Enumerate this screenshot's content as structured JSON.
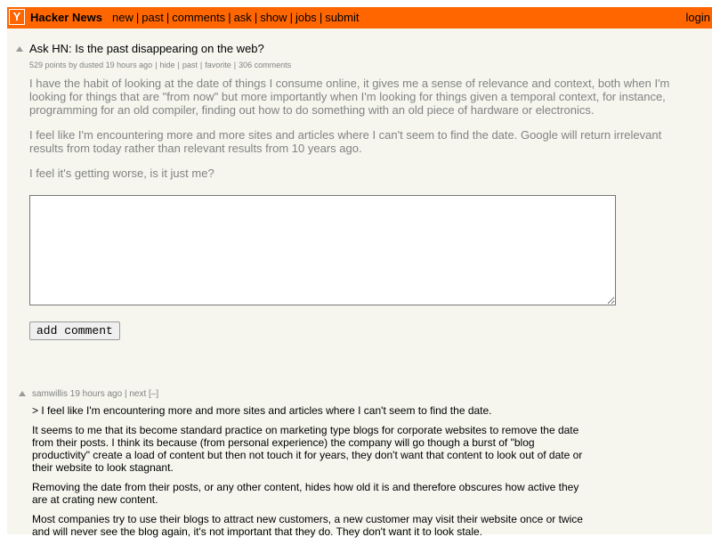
{
  "header": {
    "logo": "Y",
    "site_name": "Hacker News",
    "nav": [
      "new",
      "past",
      "comments",
      "ask",
      "show",
      "jobs",
      "submit"
    ],
    "separator": "|",
    "login": "login"
  },
  "story": {
    "title": "Ask HN: Is the past disappearing on the web?",
    "points": "529 points",
    "by": "by",
    "user": "dusted",
    "age": "19 hours ago",
    "links": [
      "hide",
      "past",
      "favorite",
      "306 comments"
    ],
    "paragraphs": [
      "I have the habit of looking at the date of things I consume online, it gives me a sense of relevance and context, both when I'm looking for things that are \"from now\" but more importantly when I'm looking for things given a temporal context, for instance, programming for an old compiler, finding out how to do something with an old piece of hardware or electronics.",
      "I feel like I'm encountering more and more sites and articles where I can't seem to find the date. Google will return irrelevant results from today rather than relevant results from 10 years ago.",
      "I feel it's getting worse, is it just me?"
    ]
  },
  "reply": {
    "textarea_value": "",
    "button_label": "add comment"
  },
  "comment": {
    "user": "samwillis",
    "age": "19 hours ago",
    "next": "next",
    "toggle": "[–]",
    "paragraphs": [
      "> I feel like I'm encountering more and more sites and articles where I can't seem to find the date.",
      "It seems to me that its become standard practice on marketing type blogs for corporate websites to remove the date from their posts. I think its because (from personal experience) the company will go though a burst of \"blog productivity\" create a load of content but then not touch it for years, they don't want that content to look out of date or their website to look stagnant.",
      "Removing the date from their posts, or any other content, hides how old it is and therefore obscures how active they are at crating new content.",
      "Most companies try to use their blogs to attract new customers, a new customer may visit their website once or twice and will never see the blog again, it's not important that they do. They don't want it to look stale."
    ]
  },
  "colors": {
    "accent": "#ff6600",
    "page_bg": "#f6f6ef",
    "subtext": "#828282"
  }
}
